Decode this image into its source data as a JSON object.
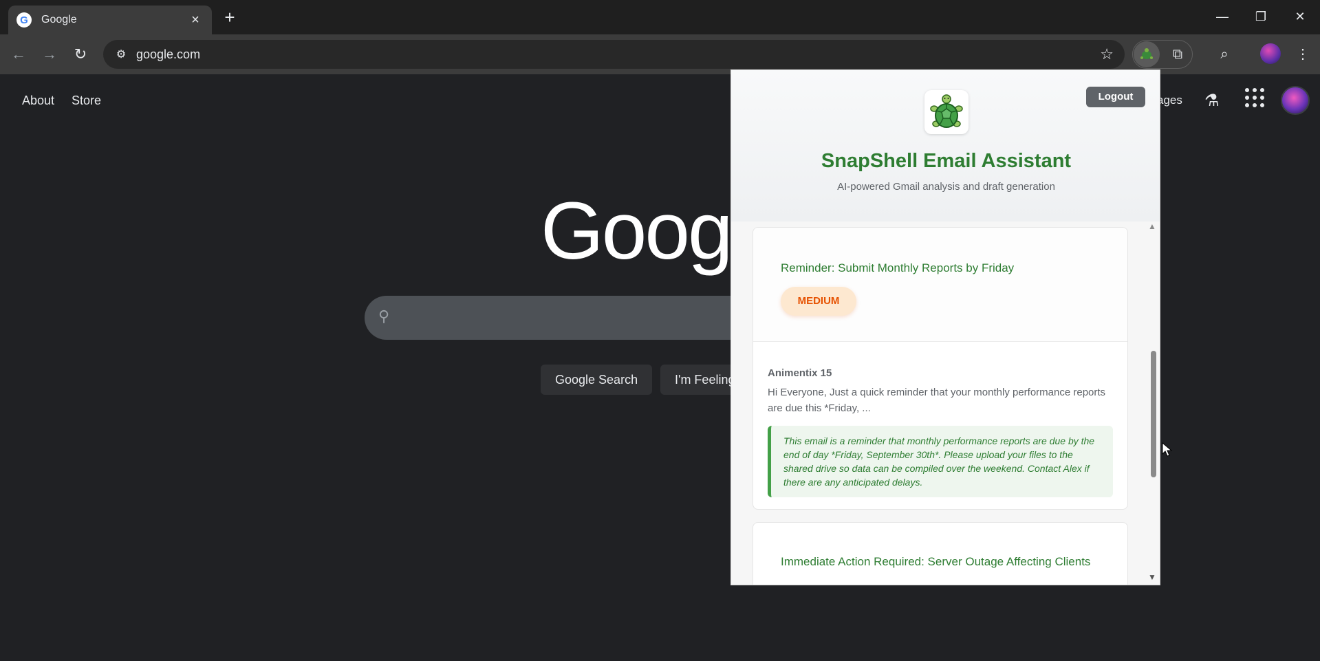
{
  "browser": {
    "tab": {
      "title": "Google",
      "favicon": "G"
    },
    "new_tab_label": "+",
    "url": "google.com",
    "window_controls": {
      "minimize": "—",
      "restore": "❐",
      "close": "✕"
    }
  },
  "google": {
    "links_left": [
      "About",
      "Store"
    ],
    "images_label": "ages",
    "logo_text": "Goog",
    "buttons": [
      "Google Search",
      "I'm Feeling"
    ]
  },
  "popup": {
    "logout_label": "Logout",
    "title": "SnapShell Email Assistant",
    "subtitle": "AI-powered Gmail analysis and draft generation",
    "emails": [
      {
        "subject": "Reminder: Submit Monthly Reports by Friday",
        "priority": "MEDIUM",
        "sender": "Animentix 15",
        "snippet": "Hi Everyone, Just a quick reminder that your monthly performance reports are due this *Friday, ...",
        "summary": "This email is a reminder that monthly performance reports are due by the end of day *Friday, September 30th*. Please upload your files to the shared drive so data can be compiled over the weekend. Contact Alex if there are any anticipated delays."
      },
      {
        "subject": "Immediate Action Required: Server Outage Affecting Clients"
      }
    ]
  },
  "colors": {
    "accent_green": "#2e7d32",
    "priority_medium": "#e65100",
    "browser_bg": "#202124"
  }
}
